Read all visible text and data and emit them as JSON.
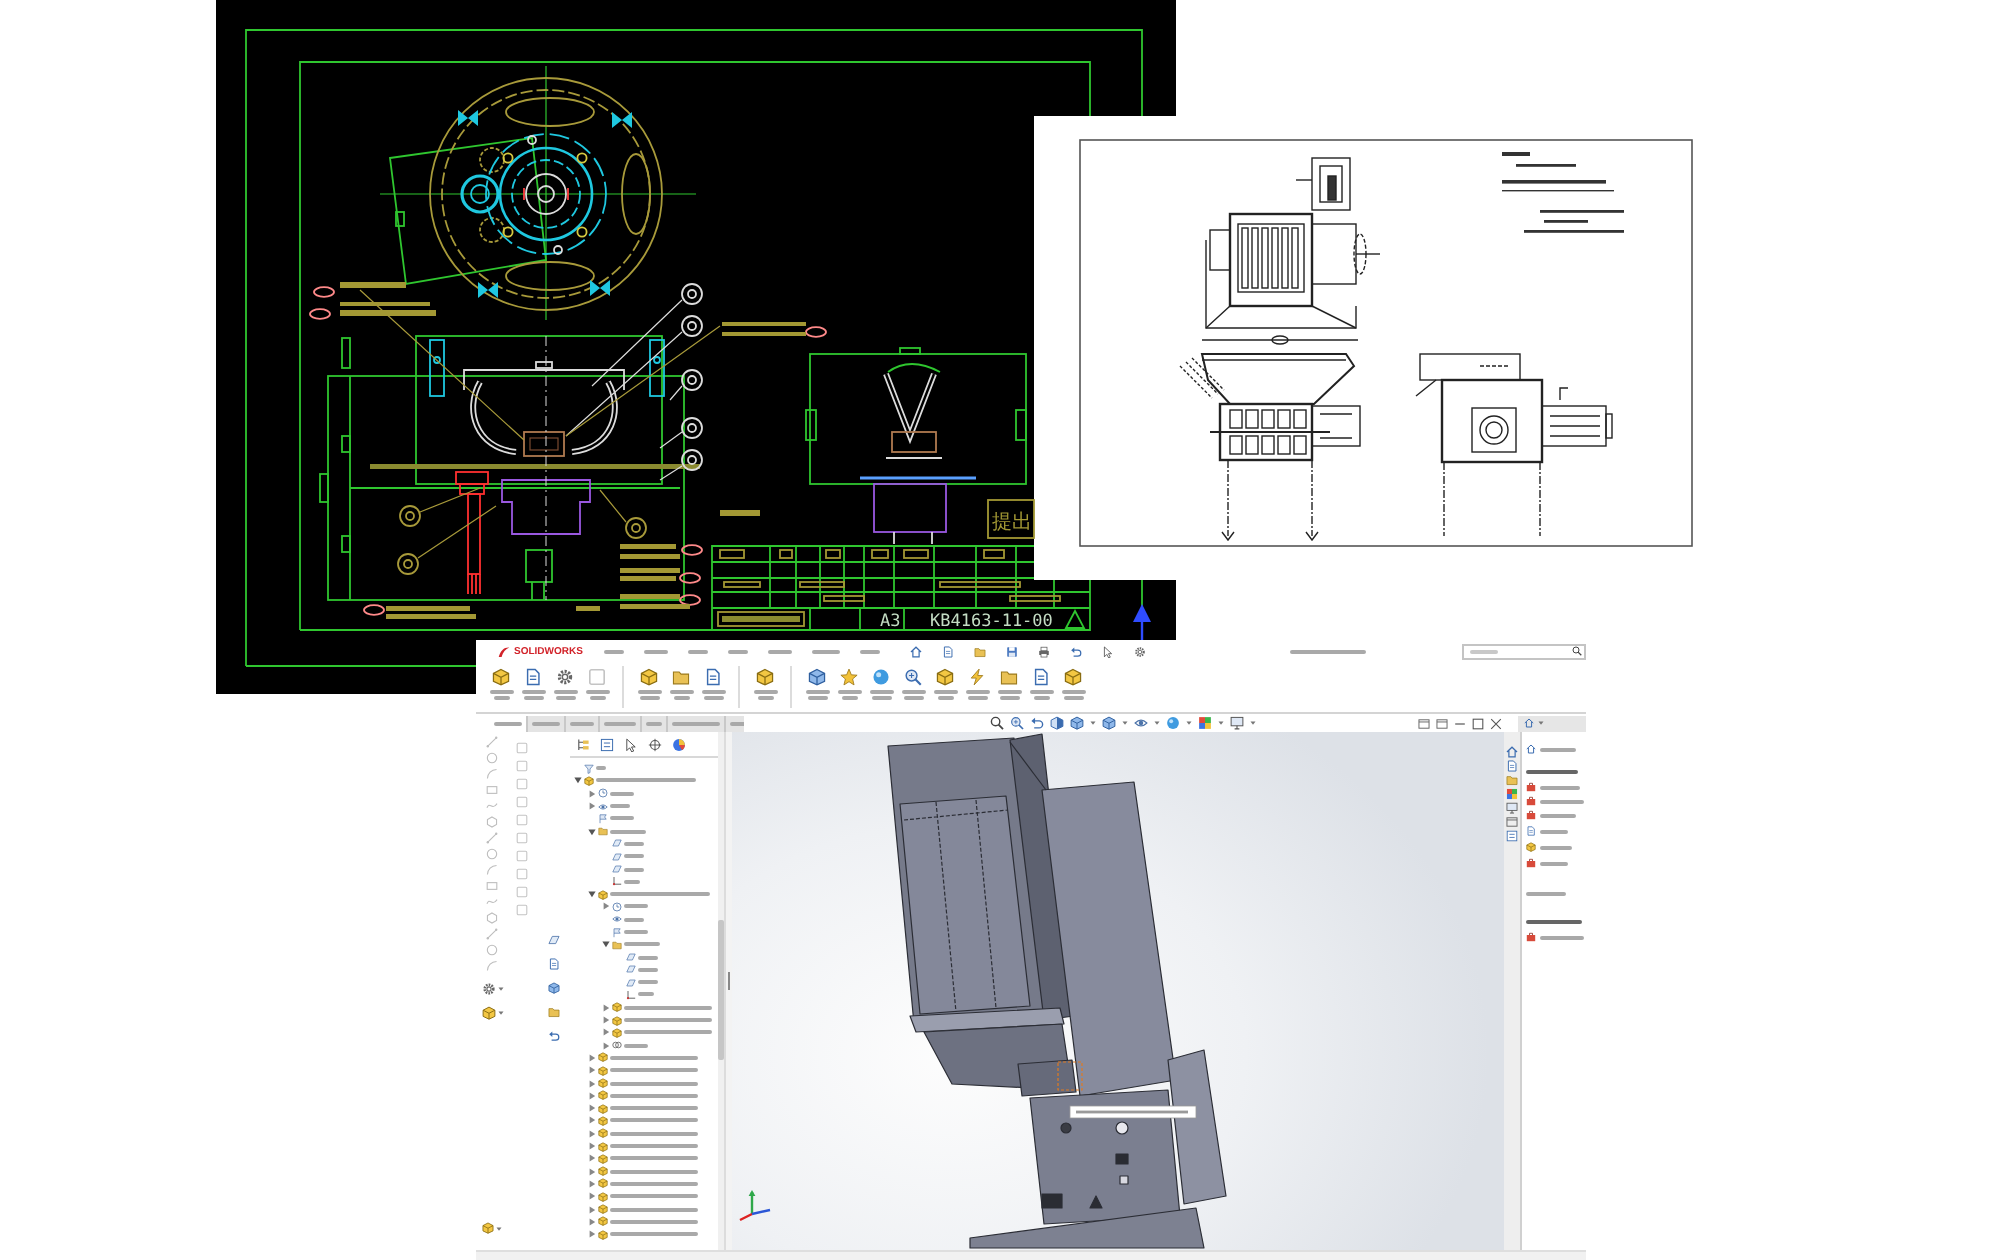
{
  "cad_sheet": {
    "stamp": "提出",
    "sheet_size": "A3",
    "drawing_number": "KB4163-11-00"
  },
  "cad_window": {
    "logo": "SOLIDWORKS",
    "command_tabs": [
      {
        "selected": true
      },
      {
        "selected": false
      },
      {
        "selected": false
      },
      {
        "selected": false
      },
      {
        "selected": false
      },
      {
        "selected": false
      },
      {
        "selected": false
      }
    ],
    "feature_tree": [
      {
        "kind": "filter"
      },
      {
        "kind": "assembly",
        "expanded": true,
        "children": [
          {
            "kind": "history",
            "expanded": false
          },
          {
            "kind": "sensor",
            "expanded": false
          },
          {
            "kind": "annotation"
          },
          {
            "kind": "folder",
            "expanded": true,
            "children": [
              {
                "kind": "plane"
              },
              {
                "kind": "plane"
              },
              {
                "kind": "plane"
              },
              {
                "kind": "origin"
              }
            ]
          },
          {
            "kind": "assembly",
            "expanded": true,
            "children": [
              {
                "kind": "history",
                "expanded": false
              },
              {
                "kind": "sensor"
              },
              {
                "kind": "annotation"
              },
              {
                "kind": "folder",
                "expanded": true,
                "children": [
                  {
                    "kind": "plane"
                  },
                  {
                    "kind": "plane"
                  },
                  {
                    "kind": "plane"
                  },
                  {
                    "kind": "origin"
                  }
                ]
              },
              {
                "kind": "part",
                "expanded": false
              },
              {
                "kind": "part",
                "expanded": false
              },
              {
                "kind": "part",
                "expanded": false
              },
              {
                "kind": "mates",
                "expanded": false
              }
            ]
          },
          {
            "kind": "part",
            "expanded": false
          },
          {
            "kind": "part",
            "expanded": false
          },
          {
            "kind": "part",
            "expanded": false
          },
          {
            "kind": "part",
            "expanded": false
          },
          {
            "kind": "part",
            "expanded": false
          },
          {
            "kind": "part",
            "expanded": false
          },
          {
            "kind": "part",
            "expanded": false
          },
          {
            "kind": "part",
            "expanded": false
          },
          {
            "kind": "part",
            "expanded": false
          },
          {
            "kind": "part",
            "expanded": false
          },
          {
            "kind": "part",
            "expanded": false
          },
          {
            "kind": "part",
            "expanded": false
          },
          {
            "kind": "part",
            "expanded": false
          },
          {
            "kind": "part",
            "expanded": false
          },
          {
            "kind": "part",
            "expanded": false
          }
        ]
      }
    ]
  }
}
